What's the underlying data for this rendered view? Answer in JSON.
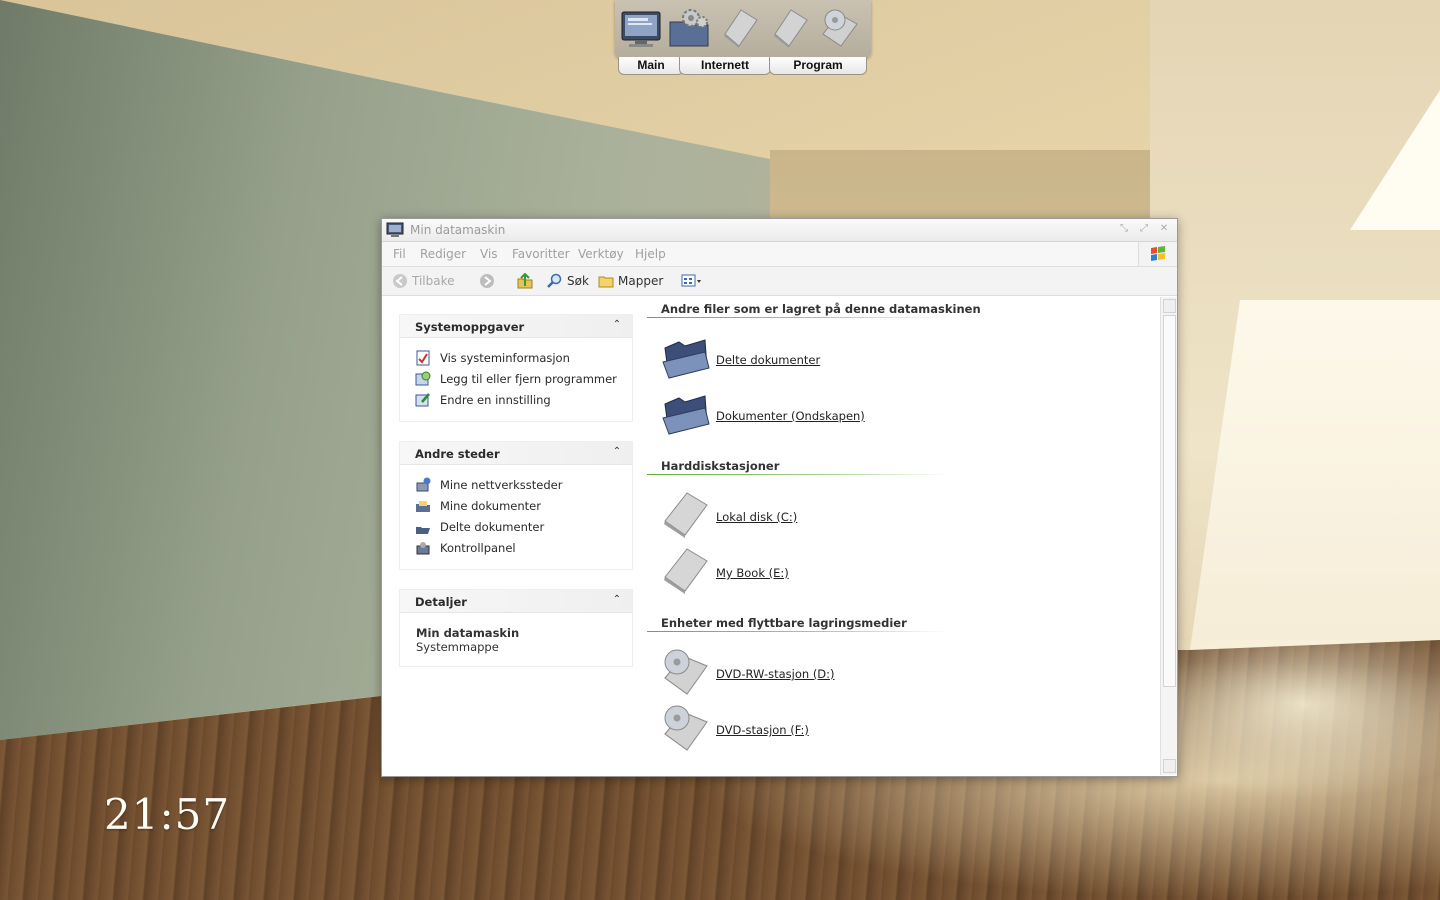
{
  "dock": {
    "icons": [
      "computer-icon",
      "gear-folder-icon",
      "blank-drive-icon",
      "blank-drive-icon",
      "cd-drive-icon"
    ],
    "tabs": [
      "Main",
      "Internett",
      "Program"
    ]
  },
  "clock": {
    "time": "21:57"
  },
  "window": {
    "title": "Min datamaskin",
    "menu": [
      "Fil",
      "Rediger",
      "Vis",
      "Favoritter",
      "Verktøy",
      "Hjelp"
    ],
    "toolbar": {
      "back": "Tilbake",
      "search": "Søk",
      "folders": "Mapper"
    },
    "task_pane": {
      "system": {
        "title": "Systemoppgaver",
        "links": [
          "Vis systeminformasjon",
          "Legg til eller fjern programmer",
          "Endre en innstilling"
        ]
      },
      "other_places": {
        "title": "Andre steder",
        "links": [
          "Mine nettverkssteder",
          "Mine dokumenter",
          "Delte dokumenter",
          "Kontrollpanel"
        ]
      },
      "details": {
        "title": "Detaljer",
        "name": "Min datamaskin",
        "type": "Systemmappe"
      }
    },
    "groups": [
      {
        "title": "Andre filer som er lagret på denne datamaskinen",
        "items": [
          "Delte dokumenter",
          "Dokumenter (Ondskapen)"
        ]
      },
      {
        "title": "Harddiskstasjoner",
        "items": [
          "Lokal disk (C:)",
          "My Book (E:)"
        ]
      },
      {
        "title": "Enheter med flyttbare lagringsmedier",
        "items": [
          "DVD-RW-stasjon (D:)",
          "DVD-stasjon (F:)"
        ]
      }
    ]
  },
  "colors": {
    "accent_green": "#5fae3a",
    "menu_grey": "#a0a0a0"
  }
}
